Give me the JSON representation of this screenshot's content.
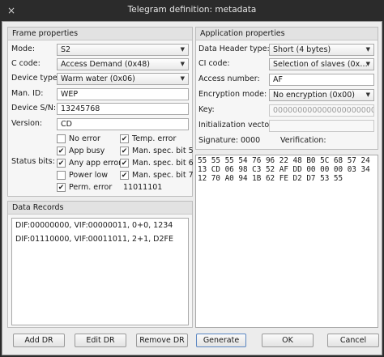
{
  "window": {
    "title": "Telegram definition: metadata",
    "close_icon": "×"
  },
  "frame": {
    "header": "Frame properties",
    "mode_label": "Mode:",
    "mode_value": "S2",
    "ccode_label": "C code:",
    "ccode_value": "Access Demand (0x48)",
    "device_type_label": "Device type:",
    "device_type_value": "Warm water (0x06)",
    "man_id_label": "Man. ID:",
    "man_id_value": "WEP",
    "device_sn_label": "Device S/N:",
    "device_sn_value": "13245768",
    "version_label": "Version:",
    "version_value": "CD",
    "status_bits_label": "Status bits:",
    "status_bits": [
      {
        "label": "No error",
        "checked": false
      },
      {
        "label": "Temp. error",
        "checked": true
      },
      {
        "label": "App busy",
        "checked": true
      },
      {
        "label": "Man. spec. bit 5",
        "checked": true
      },
      {
        "label": "Any app error",
        "checked": true
      },
      {
        "label": "Man. spec. bit 6",
        "checked": true
      },
      {
        "label": "Power low",
        "checked": false
      },
      {
        "label": "Man. spec. bit 7",
        "checked": true
      },
      {
        "label": "Perm. error",
        "checked": true
      }
    ],
    "status_bits_value": "11011101"
  },
  "app": {
    "header": "Application properties",
    "dh_type_label": "Data Header type:",
    "dh_type_value": "Short (4 bytes)",
    "ci_code_label": "CI code:",
    "ci_code_value": "Selection of slaves (0x…",
    "access_number_label": "Access number:",
    "access_number_value": "AF",
    "encryption_label": "Encryption mode:",
    "encryption_value": "No encryption (0x00)",
    "key_label": "Key:",
    "key_value": "000000000000000000000000",
    "iv_label": "Initialization vector:",
    "iv_value": "",
    "signature_label": "Signature:",
    "signature_value": "0000",
    "verification_label": "Verification:",
    "verification_value": ""
  },
  "hex_dump": "55 55 55 54 76 96 22 48 B0 5C 68 57 24 13 CD 06 98 C3 52 AF DD 00 00 00 03 34 12 70 A0 94 1B 62 FE D2 D7 53 55",
  "records": {
    "header": "Data Records",
    "items": [
      "DIF:00000000, VIF:00000011, 0+0, 1234",
      "DIF:01110000, VIF:00011011, 2+1, D2FE"
    ]
  },
  "buttons": {
    "add_dr": "Add DR",
    "edit_dr": "Edit DR",
    "remove_dr": "Remove DR",
    "generate": "Generate",
    "ok": "OK",
    "cancel": "Cancel"
  },
  "icons": {
    "dropdown_arrow": "▼",
    "checkmark": "✔"
  }
}
